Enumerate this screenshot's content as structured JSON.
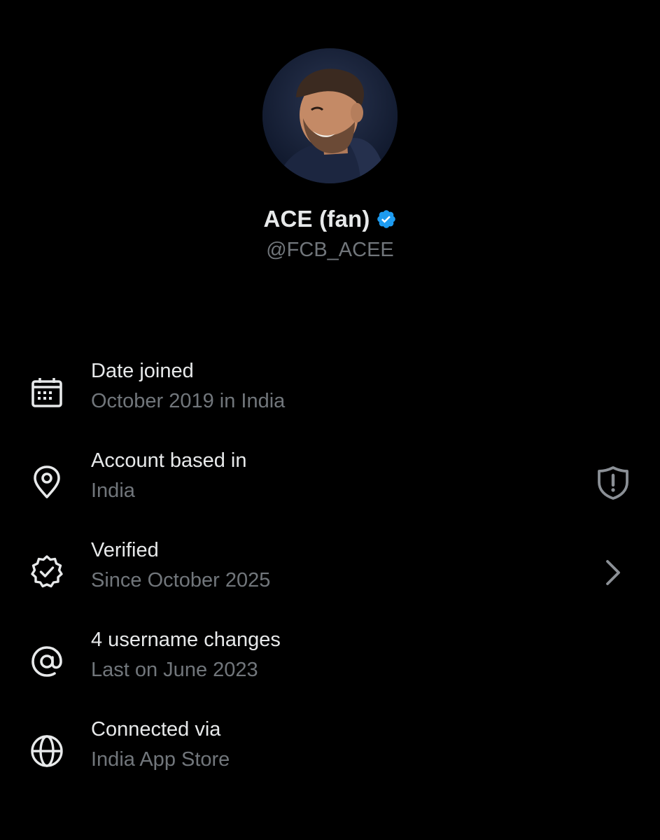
{
  "profile": {
    "display_name": "ACE (fan)",
    "handle": "@FCB_ACEE",
    "verified_color": "#1d9bf0",
    "avatar": "profile-photo"
  },
  "rows": [
    {
      "icon": "calendar-icon",
      "title": "Date joined",
      "subtitle": "October 2019 in India"
    },
    {
      "icon": "location-pin-icon",
      "title": "Account based in",
      "subtitle": "India",
      "trailing_icon": "shield-alert-icon"
    },
    {
      "icon": "verified-badge-icon",
      "title": "Verified",
      "subtitle": "Since October 2025",
      "trailing_icon": "chevron-right-icon"
    },
    {
      "icon": "at-sign-icon",
      "title": "4 username changes",
      "subtitle": "Last on June 2023"
    },
    {
      "icon": "globe-icon",
      "title": "Connected via",
      "subtitle": "India App Store"
    }
  ],
  "colors": {
    "background": "#000000",
    "primary_text": "#e7e9ea",
    "secondary_text": "#71767b"
  }
}
